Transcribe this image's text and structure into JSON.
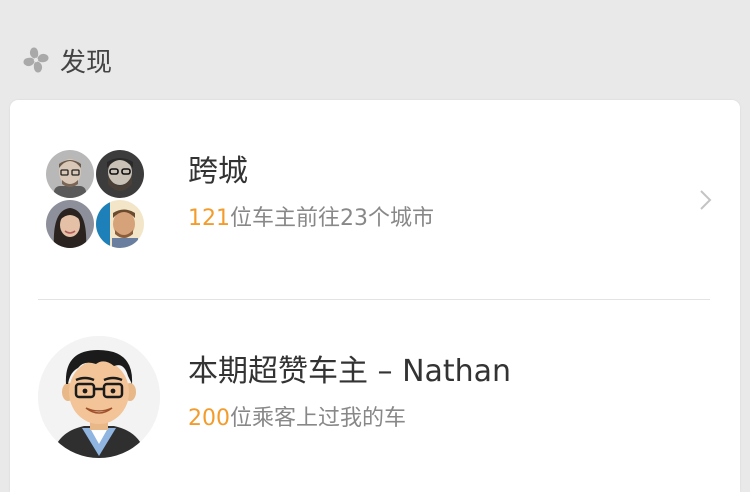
{
  "section": {
    "title": "发现",
    "icon": "flower-icon"
  },
  "items": [
    {
      "title": "跨城",
      "subtitle_count": "121",
      "subtitle_rest": "位车主前往23个城市",
      "icon": "chevron-right-icon"
    },
    {
      "title": "本期超赞车主 – Nathan",
      "subtitle_count": "200",
      "subtitle_rest": "位乘客上过我的车"
    }
  ],
  "colors": {
    "accent": "#f39c2c",
    "background": "#e9e9e9",
    "card": "#ffffff"
  }
}
